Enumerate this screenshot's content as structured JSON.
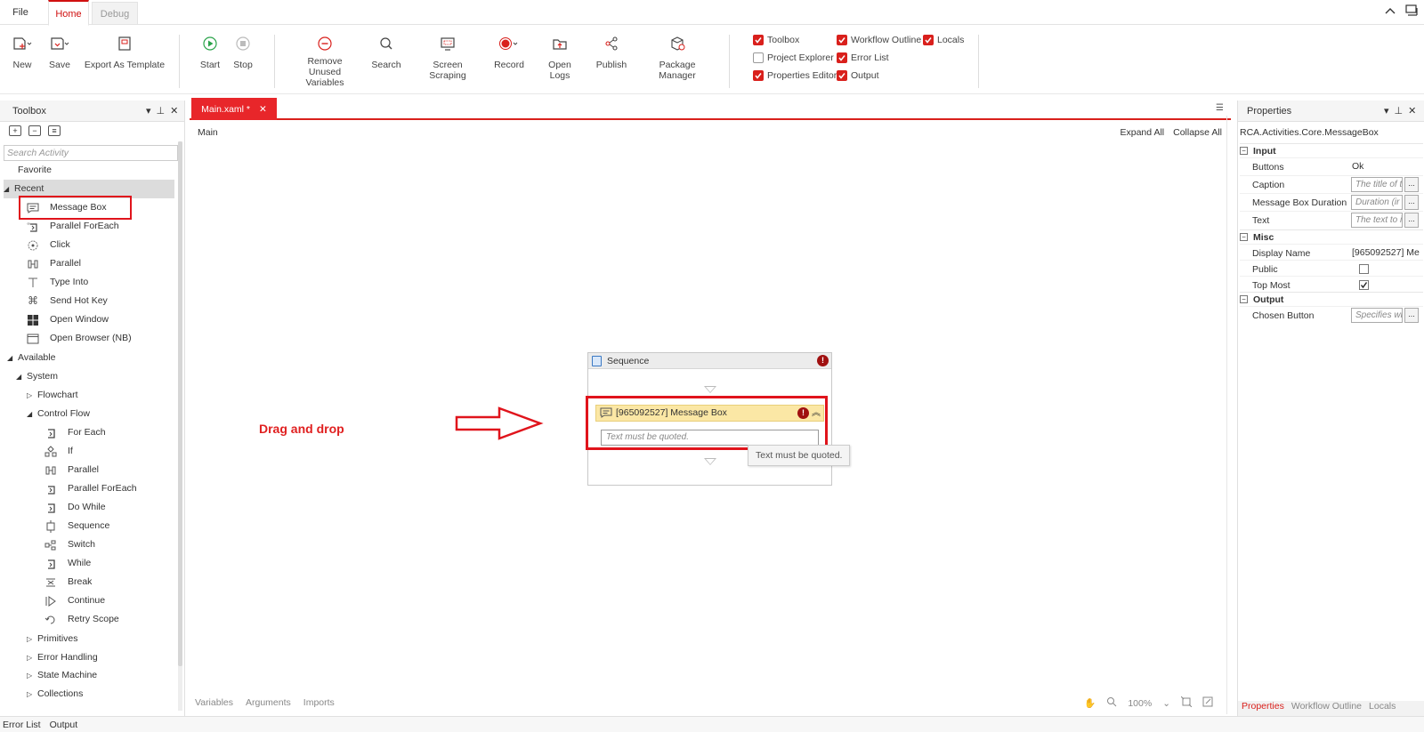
{
  "menu": {
    "file": "File",
    "home": "Home",
    "debug": "Debug"
  },
  "ribbon": {
    "new": "New",
    "save": "Save",
    "export_template": "Export As Template",
    "start": "Start",
    "stop": "Stop",
    "remove_unused": "Remove Unused",
    "remove_unused_2": "Variables",
    "search": "Search",
    "screen_scraping": "Screen Scraping",
    "record": "Record",
    "open_logs": "Open Logs",
    "publish": "Publish",
    "package_manager": "Package Manager",
    "panels": [
      {
        "label": "Toolbox",
        "checked": true
      },
      {
        "label": "Project Explorer",
        "checked": false
      },
      {
        "label": "Properties Editor",
        "checked": true
      },
      {
        "label": "Workflow Outline",
        "checked": true
      },
      {
        "label": "Error List",
        "checked": true
      },
      {
        "label": "Output",
        "checked": true
      },
      {
        "label": "Locals",
        "checked": true
      }
    ]
  },
  "toolbox": {
    "title": "Toolbox",
    "search_placeholder": "Search Activity",
    "favorite": "Favorite",
    "recent": "Recent",
    "recent_items": [
      "Message Box",
      "Parallel ForEach",
      "Click",
      "Parallel",
      "Type Into",
      "Send Hot Key",
      "Open Window",
      "Open Browser (NB)"
    ],
    "available": "Available",
    "system": "System",
    "flowchart": "Flowchart",
    "control_flow": "Control Flow",
    "control_flow_items": [
      "For Each",
      "If",
      "Parallel",
      "Parallel ForEach",
      "Do While",
      "Sequence",
      "Switch",
      "While",
      "Break",
      "Continue",
      "Retry Scope"
    ],
    "primitives": "Primitives",
    "error_handling": "Error Handling",
    "state_machine": "State Machine",
    "collections": "Collections"
  },
  "document": {
    "tab": "Main.xaml *",
    "breadcrumb": "Main",
    "expand_all": "Expand All",
    "collapse_all": "Collapse All",
    "annotation": "Drag and drop",
    "sequence_title": "Sequence",
    "message_box_title": "[965092527] Message Box",
    "message_box_placeholder": "Text must be quoted.",
    "tooltip": "Text must be quoted.",
    "footer_tabs": [
      "Variables",
      "Arguments",
      "Imports"
    ],
    "zoom": "100%"
  },
  "properties": {
    "title": "Properties",
    "type": "RCA.Activities.Core.MessageBox",
    "input_cat": "Input",
    "buttons": {
      "name": "Buttons",
      "value": "Ok"
    },
    "caption": {
      "name": "Caption",
      "placeholder": "The title of t"
    },
    "duration": {
      "name": "Message Box Duration",
      "placeholder": "Duration (ir"
    },
    "text": {
      "name": "Text",
      "placeholder": "The text to i"
    },
    "misc_cat": "Misc",
    "display_name": {
      "name": "Display Name",
      "value": "[965092527] Mes"
    },
    "public": {
      "name": "Public",
      "checked": false
    },
    "top_most": {
      "name": "Top Most",
      "checked": true
    },
    "output_cat": "Output",
    "chosen_button": {
      "name": "Chosen Button",
      "placeholder": "Specifies wh"
    },
    "footer_tabs": [
      "Properties",
      "Workflow Outline",
      "Locals"
    ],
    "dots": "..."
  },
  "statusbar": {
    "error_list": "Error List",
    "output": "Output"
  },
  "colors": {
    "accent": "#d9201c",
    "highlight": "#e0141c",
    "activity_header": "#fbe7a5"
  }
}
